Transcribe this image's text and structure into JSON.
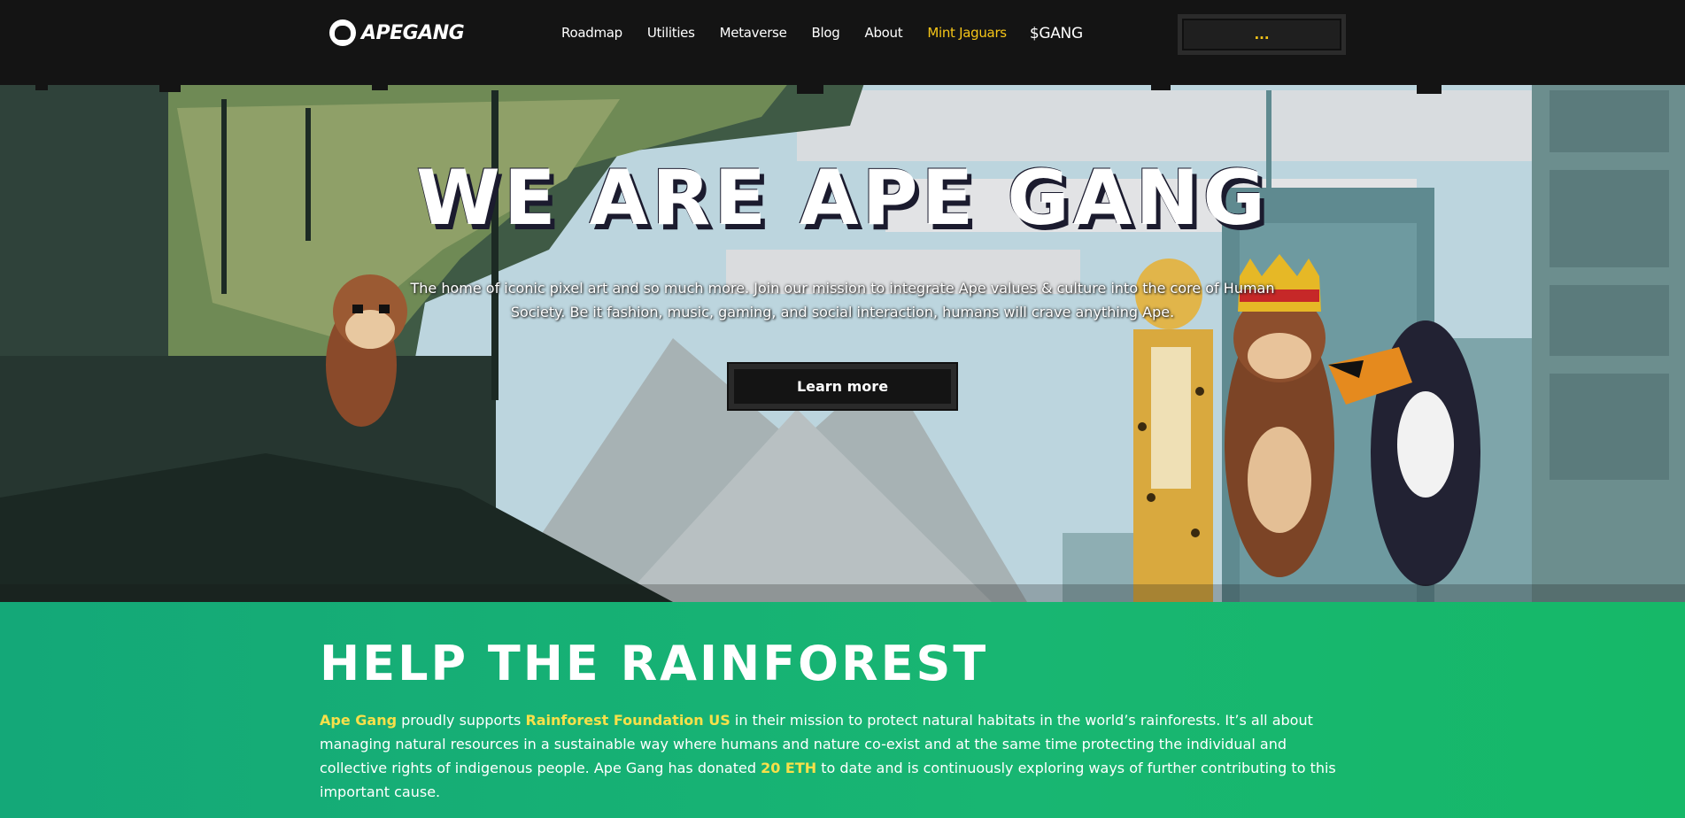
{
  "brand": {
    "logo_text": "APEGANG",
    "logo_icon": "ape-logo-icon"
  },
  "nav": {
    "items": [
      {
        "label": "Roadmap"
      },
      {
        "label": "Utilities"
      },
      {
        "label": "Metaverse"
      },
      {
        "label": "Blog"
      },
      {
        "label": "About"
      },
      {
        "label": "Mint Jaguars"
      },
      {
        "label": "$GANG"
      }
    ],
    "wallet_button": "..."
  },
  "hero": {
    "title": "WE ARE APE GANG",
    "subtitle": "The home of iconic pixel art and so much more. Join our mission to integrate Ape values & culture into the core of Human Society. Be it fashion, music, gaming, and social interaction, humans will crave anything Ape.",
    "cta": "Learn more"
  },
  "rainforest": {
    "title": "HELP THE RAINFOREST",
    "p1_hl1": "Ape Gang",
    "p1_t1": " proudly supports ",
    "p1_hl2": "Rainforest Foundation US",
    "p1_t2": " in their mission to protect natural habitats in the world’s rainforests. It’s all about managing natural resources in a sustainable way where humans and nature co-exist and at the same time protecting the individual and collective rights of indigenous people. Ape Gang has donated ",
    "p1_hl3": "20 ETH",
    "p1_t3": " to date and is continuously exploring ways of further contributing to this important cause."
  },
  "colors": {
    "nav_bg": "#141414",
    "accent": "#f5c518",
    "rainforest_bg": "#16b270",
    "highlight": "#f7e04a"
  }
}
